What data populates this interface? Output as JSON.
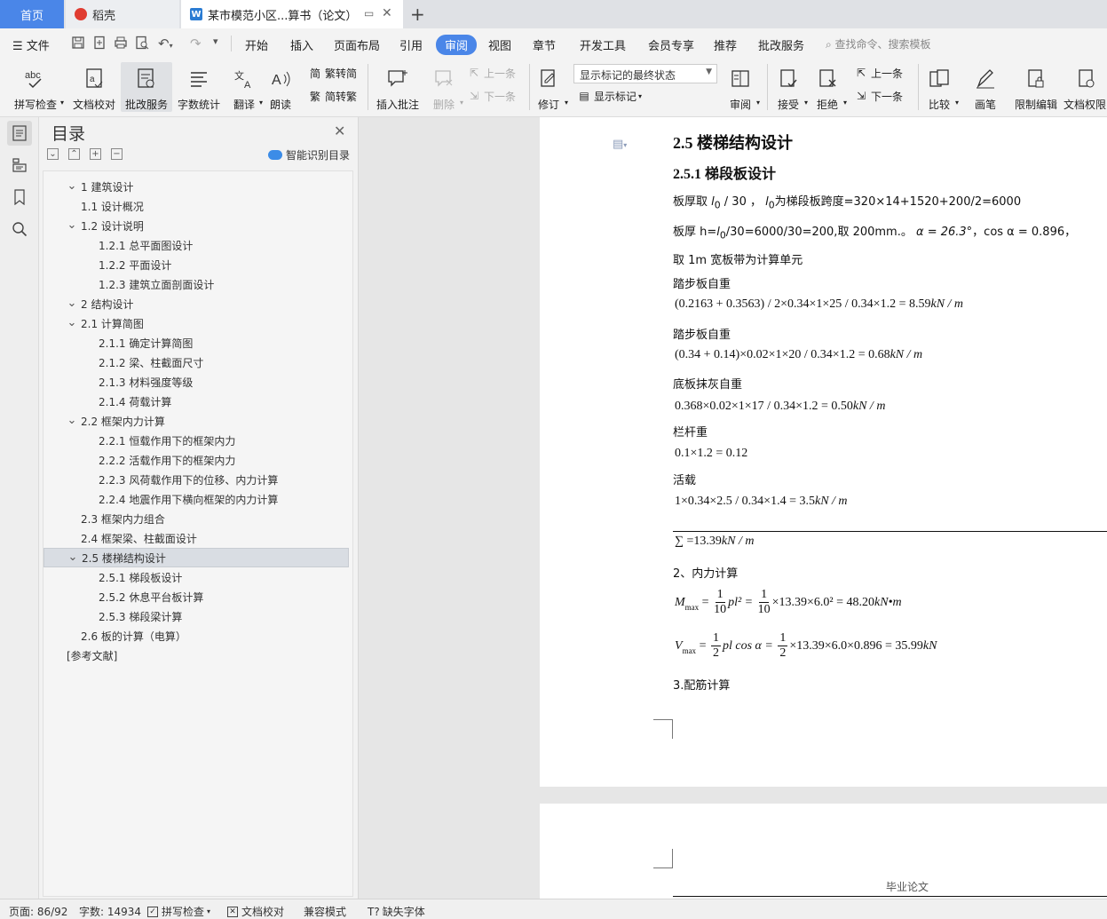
{
  "tabs": {
    "home": "首页",
    "daoke": "稻壳",
    "doc": "某市模范小区...算书（论文）"
  },
  "menu": {
    "file": "文件",
    "items": [
      "开始",
      "插入",
      "页面布局",
      "引用",
      "审阅",
      "视图",
      "章节",
      "开发工具",
      "会员专享",
      "推荐",
      "批改服务"
    ],
    "active": "审阅",
    "search_placeholder": "查找命令、搜索模板"
  },
  "ribbon": {
    "spellcheck": "拼写检查",
    "doc_check": "文档校对",
    "correction": "批改服务",
    "word_count": "字数统计",
    "translate": "翻译",
    "read_aloud": "朗读",
    "to_traditional": "繁转简",
    "to_simplified": "简转繁",
    "insert_comment": "插入批注",
    "delete": "删除",
    "prev_comment": "上一条",
    "next_comment": "下一条",
    "revise": "修订",
    "markup_state": "显示标记的最终状态",
    "show_markup": "显示标记",
    "review": "审阅",
    "accept": "接受",
    "reject": "拒绝",
    "prev_change": "上一条",
    "next_change": "下一条",
    "compare": "比较",
    "pen": "画笔",
    "restrict": "限制编辑",
    "doc_rights": "文档权限"
  },
  "toc": {
    "title": "目录",
    "smart": "智能识别目录",
    "items": [
      {
        "text": "1  建筑设计",
        "level": 1,
        "chev": true
      },
      {
        "text": "1.1  设计概况",
        "level": 2,
        "chev": false
      },
      {
        "text": "1.2  设计说明",
        "level": 2,
        "chev": true
      },
      {
        "text": "1.2.1  总平面图设计",
        "level": 3,
        "chev": false
      },
      {
        "text": "1.2.2  平面设计",
        "level": 3,
        "chev": false
      },
      {
        "text": "1.2.3 建筑立面剖面设计",
        "level": 3,
        "chev": false
      },
      {
        "text": "2  结构设计",
        "level": 1,
        "chev": true
      },
      {
        "text": "2.1  计算简图",
        "level": 2,
        "chev": true
      },
      {
        "text": "2.1.1  确定计算简图",
        "level": 3,
        "chev": false
      },
      {
        "text": "2.1.2  梁、柱截面尺寸",
        "level": 3,
        "chev": false
      },
      {
        "text": "2.1.3  材料强度等级",
        "level": 3,
        "chev": false
      },
      {
        "text": "2.1.4  荷载计算",
        "level": 3,
        "chev": false
      },
      {
        "text": "2.2  框架内力计算",
        "level": 2,
        "chev": true
      },
      {
        "text": "2.2.1  恒载作用下的框架内力",
        "level": 3,
        "chev": false
      },
      {
        "text": "2.2.2  活载作用下的框架内力",
        "level": 3,
        "chev": false
      },
      {
        "text": "2.2.3  风荷载作用下的位移、内力计算",
        "level": 3,
        "chev": false
      },
      {
        "text": "2.2.4 地震作用下横向框架的内力计算",
        "level": 3,
        "chev": false
      },
      {
        "text": "2.3  框架内力组合",
        "level": 2,
        "chev": false
      },
      {
        "text": "2.4  框架梁、柱截面设计",
        "level": 2,
        "chev": false
      },
      {
        "text": "2.5 楼梯结构设计",
        "level": 2,
        "chev": true,
        "selected": true
      },
      {
        "text": "2.5.1  梯段板设计",
        "level": 3,
        "chev": false
      },
      {
        "text": "2.5.2  休息平台板计算",
        "level": 3,
        "chev": false
      },
      {
        "text": "2.5.3  梯段梁计算",
        "level": 3,
        "chev": false
      },
      {
        "text": "2.6 板的计算（电算）",
        "level": 2,
        "chev": false
      },
      {
        "text": "[参考文献]",
        "level": 0,
        "chev": false
      }
    ]
  },
  "doc": {
    "h_25": "2.5 楼梯结构设计",
    "h_251": "2.5.1  梯段板设计",
    "line1_a": "板厚取 ",
    "line1_l0": "l",
    "line1_sub": "0",
    "line1_b": " / 30 ，",
    "line1_c": "为梯段板跨度=320×14+1520+200/2=6000",
    "line2_a": "板厚 h=",
    "line2_b": "/30=6000/30=200,取 200mm.。",
    "line2_alpha": "α = 26.3°",
    "line2_cos": "，cos α = 0.896，",
    "line3": "取 1m 宽板带为计算单元",
    "label_step": "踏步板自重",
    "f_step": "(0.2163 + 0.3563) / 2×0.34×1×25 / 0.34×1.2 = 8.59",
    "unit_knm": "kN / m",
    "label_step2": "踏步板自重",
    "f_step2": "(0.34 + 0.14)×0.02×1×20 / 0.34×1.2 = 0.68",
    "label_plaster": "底板抹灰自重",
    "f_plaster": "0.368×0.02×1×17 / 0.34×1.2 = 0.50",
    "label_rail": "栏杆重",
    "f_rail": "0.1×1.2 = 0.12",
    "label_live": "活载",
    "f_live": "1×0.34×2.5 / 0.34×1.4 = 3.5",
    "f_sum": "∑ =13.39",
    "label_internal": "2、内力计算",
    "m_left": "M",
    "m_sub": "max",
    "m_mid1": "pl² =",
    "m_mid2": "×13.39×6.0² = 48.20",
    "m_unit": "kN•m",
    "v_left": "V",
    "v_mid1": "pl cos α =",
    "v_mid2": "×13.39×6.0×0.896 = 35.99",
    "v_unit": "kN",
    "frac_one": "1",
    "frac_ten": "10",
    "frac_two": "2",
    "label_rebar": "3.配筋计算",
    "footer": "毕业论文"
  },
  "status": {
    "page": "页面: 86/92",
    "words": "字数: 14934",
    "spell": "拼写检查",
    "check": "文档校对",
    "compat": "兼容模式",
    "missing_font": "缺失字体"
  },
  "colors": {
    "accent": "#4a86e8",
    "selection": "#d9dde3"
  }
}
